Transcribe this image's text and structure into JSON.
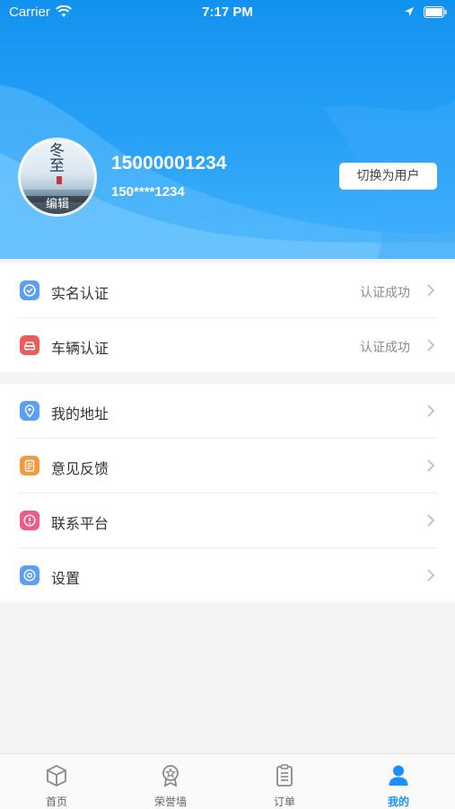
{
  "status_bar": {
    "carrier": "Carrier",
    "time": "7:17 PM"
  },
  "profile": {
    "avatar_poem": "冬至",
    "avatar_edit_label": "编辑",
    "phone": "15000001234",
    "masked_phone": "150****1234",
    "switch_button_label": "切换为用户"
  },
  "menu": {
    "group1": [
      {
        "label": "实名认证",
        "value": "认证成功",
        "icon": "verify-icon",
        "color": "#5b9ff5"
      },
      {
        "label": "车辆认证",
        "value": "认证成功",
        "icon": "car-icon",
        "color": "#ef5a5a"
      }
    ],
    "group2": [
      {
        "label": "我的地址",
        "value": "",
        "icon": "location-icon",
        "color": "#5b9ff5"
      },
      {
        "label": "意见反馈",
        "value": "",
        "icon": "feedback-icon",
        "color": "#f59a3c"
      },
      {
        "label": "联系平台",
        "value": "",
        "icon": "contact-icon",
        "color": "#ee5a8a"
      },
      {
        "label": "设置",
        "value": "",
        "icon": "settings-icon",
        "color": "#5b9ff5"
      }
    ]
  },
  "tabbar": {
    "tabs": [
      {
        "label": "首页",
        "icon": "home-icon",
        "active": false
      },
      {
        "label": "荣誉墙",
        "icon": "honor-icon",
        "active": false
      },
      {
        "label": "订单",
        "icon": "orders-icon",
        "active": false
      },
      {
        "label": "我的",
        "icon": "profile-icon",
        "active": true
      }
    ]
  },
  "colors": {
    "header_blue": "#1592f0",
    "tab_active": "#1890ff"
  }
}
